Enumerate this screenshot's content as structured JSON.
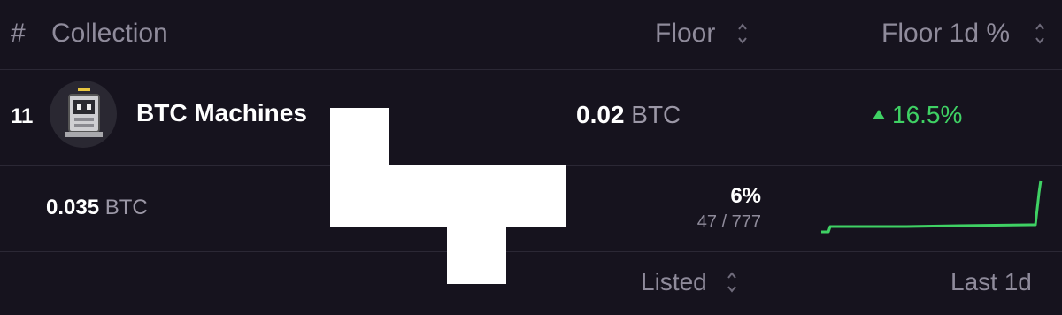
{
  "header": {
    "rank_label": "#",
    "collection_label": "Collection",
    "floor_label": "Floor",
    "floor_1d_label": "Floor 1d %"
  },
  "row": {
    "rank": "11",
    "name": "BTC Machines",
    "floor_value": "0.02",
    "floor_unit": "BTC",
    "floor_change": "16.5%",
    "floor_change_direction": "up",
    "second_value": "0.035",
    "second_unit": "BTC",
    "listed_pct": "6%",
    "listed_count": "47 / 777"
  },
  "footer": {
    "listed_label": "Listed",
    "last_1d_label": "Last 1d"
  },
  "colors": {
    "background": "#16131e",
    "muted": "#8f8b9b",
    "positive": "#3fd164"
  }
}
